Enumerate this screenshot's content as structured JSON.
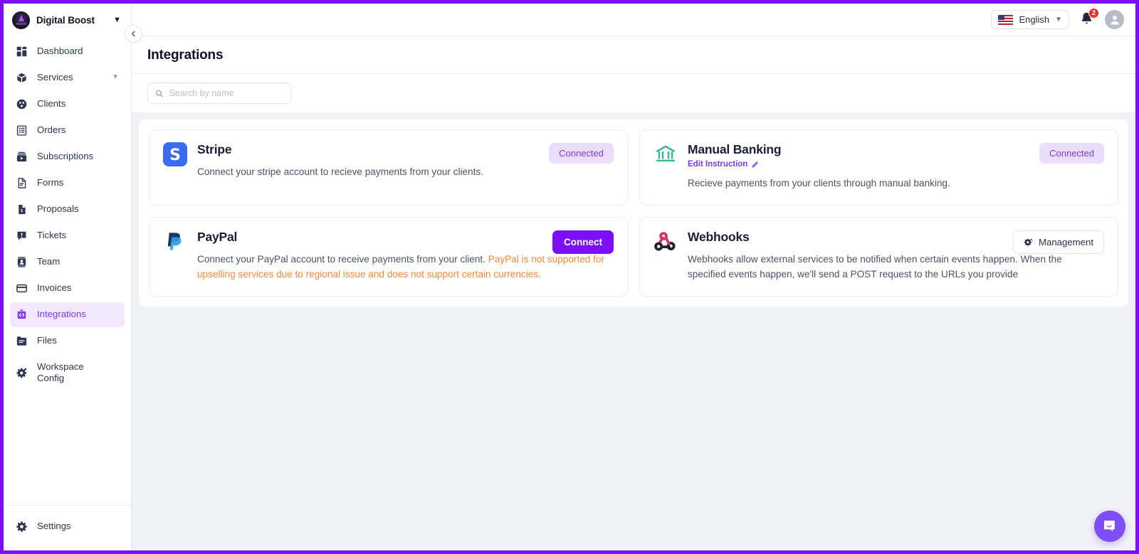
{
  "brand": {
    "name": "Digital Boost",
    "caret": "chevron-down"
  },
  "sidebar": {
    "items": [
      {
        "label": "Dashboard",
        "icon": "dashboard-icon",
        "active": false,
        "caret": false
      },
      {
        "label": "Services",
        "icon": "box-icon",
        "active": false,
        "caret": true
      },
      {
        "label": "Clients",
        "icon": "clients-icon",
        "active": false,
        "caret": false
      },
      {
        "label": "Orders",
        "icon": "orders-icon",
        "active": false,
        "caret": false
      },
      {
        "label": "Subscriptions",
        "icon": "subscriptions-icon",
        "active": false,
        "caret": false
      },
      {
        "label": "Forms",
        "icon": "forms-icon",
        "active": false,
        "caret": false
      },
      {
        "label": "Proposals",
        "icon": "proposals-icon",
        "active": false,
        "caret": false
      },
      {
        "label": "Tickets",
        "icon": "tickets-icon",
        "active": false,
        "caret": false
      },
      {
        "label": "Team",
        "icon": "team-icon",
        "active": false,
        "caret": false
      },
      {
        "label": "Invoices",
        "icon": "invoices-icon",
        "active": false,
        "caret": false
      },
      {
        "label": "Integrations",
        "icon": "integrations-icon",
        "active": true,
        "caret": false
      },
      {
        "label": "Files",
        "icon": "files-icon",
        "active": false,
        "caret": false
      },
      {
        "label": "Workspace\nConfig",
        "icon": "workspace-config-icon",
        "active": false,
        "caret": false
      }
    ],
    "footer": {
      "label": "Settings",
      "icon": "gear-icon"
    },
    "collapse": {
      "icon": "chevron-left-icon"
    }
  },
  "topbar": {
    "language": {
      "label": "English",
      "flag": "us-flag-icon",
      "caret": "chevron-down-icon"
    },
    "notifications": {
      "icon": "bell-icon",
      "count": "2"
    },
    "avatar": {
      "icon": "user-avatar-icon"
    }
  },
  "page": {
    "title": "Integrations"
  },
  "search": {
    "placeholder": "Search by name",
    "value": "",
    "icon": "search-icon"
  },
  "cards": [
    {
      "id": "stripe",
      "title": "Stripe",
      "icon": "stripe-icon",
      "description": "Connect your stripe account to recieve payments from your clients.",
      "action": {
        "type": "badge",
        "label": "Connected"
      }
    },
    {
      "id": "manual-banking",
      "title": "Manual Banking",
      "icon": "bank-icon",
      "edit_link": {
        "label": "Edit Instruction",
        "icon": "pencil-icon"
      },
      "description": "Recieve payments from your clients through manual banking.",
      "action": {
        "type": "badge",
        "label": "Connected"
      }
    },
    {
      "id": "paypal",
      "title": "PayPal",
      "icon": "paypal-icon",
      "description": "Connect your PayPal account to receive payments from your client. ",
      "warning": "PayPal is not supported for upselling services due to regional issue and does not support ",
      "warning_link": "certain currencies",
      "warning_tail": ".",
      "action": {
        "type": "button",
        "label": "Connect"
      }
    },
    {
      "id": "webhooks",
      "title": "Webhooks",
      "icon": "webhooks-icon",
      "description": "Webhooks allow external services to be notified when certain events happen. When the specified events happen, we'll send a POST request to the URLs you provide",
      "action": {
        "type": "outline-button",
        "label": "Management",
        "icon": "gear-sparkle-icon"
      }
    }
  ],
  "chat": {
    "icon": "chat-bubble-icon"
  },
  "colors": {
    "accent": "#7c0ff5",
    "accent_soft": "#eaddfd",
    "accent_text": "#7c3aed",
    "warning": "#ef8a3c",
    "badge_red": "#ef2d2d",
    "panel_bg": "#f1f2f6"
  }
}
